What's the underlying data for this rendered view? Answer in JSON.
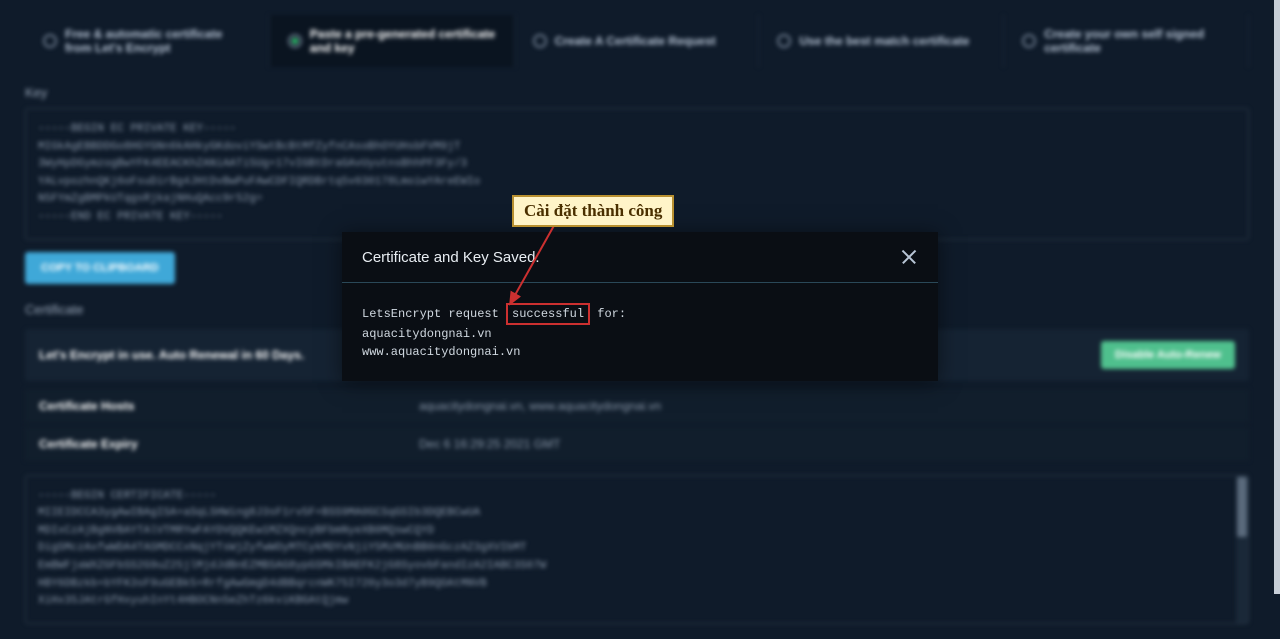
{
  "tabs": [
    {
      "label": "Free & automatic certificate from Let's Encrypt",
      "selected": false
    },
    {
      "label": "Paste a pre-generated certificate and key",
      "selected": true
    },
    {
      "label": "Create A Certificate Request",
      "selected": false
    },
    {
      "label": "Use the best match certificate",
      "selected": false
    },
    {
      "label": "Create your own self signed certificate",
      "selected": false
    }
  ],
  "key": {
    "label": "Key",
    "begin": "-----BEGIN EC PRIVATE KEY-----",
    "line1": "MIGkAgEBBDDGo8HGYGNn6kAHkyGKdoviYSwtBcBtMfZyfnCAsoBhOYUHsbFVM9jT",
    "line2": "3WyHpDGymzogBwYFK4EEACKhZANiAATi5Ug+17vIGBtDraGAvUyutnsBhhPF3Fy/3",
    "line3": "YALvpozhnQKj6oFsuDirBg4JHtDvBwPuFAwCDFIQRDBrtq5v030178LmoiwYAreEWIo",
    "line4": "N5FYmZgBMPkUTqgsRjkajNHuQAcc9r52g=",
    "end": "-----END EC PRIVATE KEY-----"
  },
  "copy_btn": "COPY TO CLIPBOARD",
  "certificate": {
    "label": "Certificate",
    "renew_text": "Let's Encrypt in use. Auto Renewal in 60 Days.",
    "auto_renew_btn": "Disable Auto-Renew",
    "hosts_label": "Certificate Hosts",
    "hosts_value": "aquacitydongnai.vn, www.aquacitydongnai.vn",
    "expiry_label": "Certificate Expiry",
    "expiry_value": "Dec 6 16:29:25 2021 GMT",
    "begin": "-----BEGIN CERTIFICATE-----",
    "line1": "MIIEIDCCA3ygAwIBAgISA+aSqLSHWing8J3sF1rv5F+BSS9MA0GCSqGSIb3DQEBCwUA",
    "line2": "MDIxCzAjBgNVBAYTAlVTMRYwFAYDVQQKEw1MZXQncyBFbmNyeXB0MQswCQYD",
    "line3": "DigSMczAxfwWDA4TASMDCCxNqjYTsWjZyfwWOyMTCykMDYvNjiY5MzMUnBB0nGczAZ3gXVIbMT",
    "line4": "EmBWFjaWXZGFbSS2G9uZ25jlMjdJdBnEZMBSAG8ypGSMkIBAEFK2jG8SyovbFandIzA2IABC3S07W",
    "line5": "HBY6DBzkb+bYFK3sF9uGEBk5+RrfgAwGmgD4dBBqrcnWK75I720y3o3d7yB9QOAtMNVB",
    "line6": "XiHx35JAtrGfHxyuhInYt4HBOCNn5eZhTz6kviKBGAtQjmw"
  },
  "modal": {
    "title": "Certificate and Key Saved.",
    "prefix": "LetsEncrypt request",
    "success": "successful",
    "suffix": "for:",
    "domain1": "aquacitydongnai.vn",
    "domain2": "www.aquacitydongnai.vn"
  },
  "callout": "Cài đặt thành công"
}
